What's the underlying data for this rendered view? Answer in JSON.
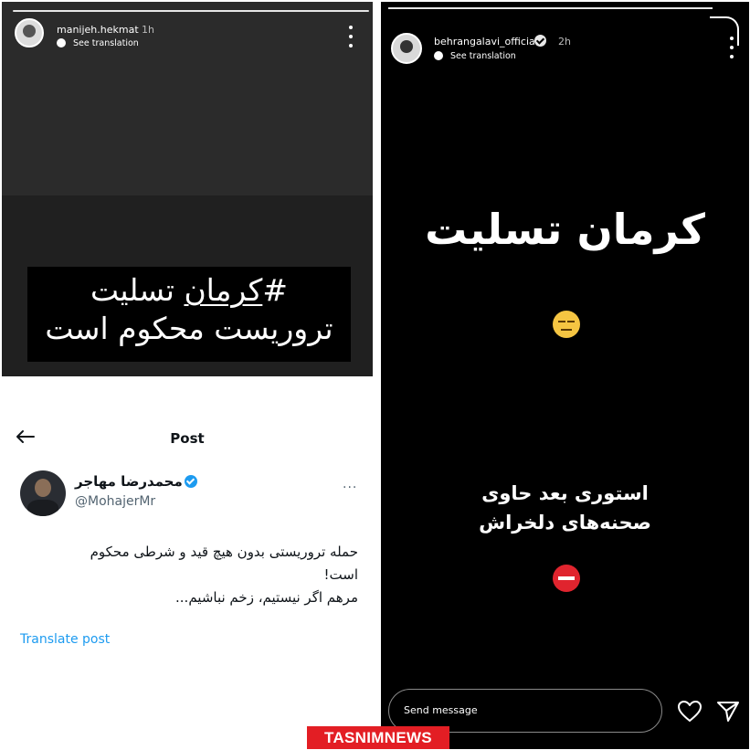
{
  "story_left": {
    "username": "manijeh.hekmat",
    "time": "1h",
    "translation_label": "See translation",
    "line1_prefix": "#",
    "line1_hashtag": "کرمان",
    "line1_rest": "تسلیت",
    "line2": "تروریست محکوم است"
  },
  "post": {
    "header_title": "Post",
    "author_name": "محمدرضا مهاجر",
    "author_handle": "@MohajerMr",
    "more_label": "···",
    "body_lines": [
      "حمله تروریستی بدون هیچ قید و شرطی محکوم",
      "است!",
      "مرهم اگر نیستیم، زخم نباشیم..."
    ],
    "translate_label": "Translate post",
    "accent_color": "#1d9bf0"
  },
  "story_right": {
    "username": "behrangalavi_official",
    "time": "2h",
    "translation_label": "See translation",
    "headline": "کرمان تسلیت",
    "emoji_1": "expressionless-face-emoji",
    "subtitle_lines": [
      "استوری بعد حاوی",
      "صحنه‌های دلخراش"
    ],
    "emoji_2": "no-entry-emoji",
    "send_placeholder": "Send message"
  },
  "watermark": "TASNIMNEWS",
  "colors": {
    "watermark_bg": "#e31e24",
    "story_bg": "#000000"
  }
}
